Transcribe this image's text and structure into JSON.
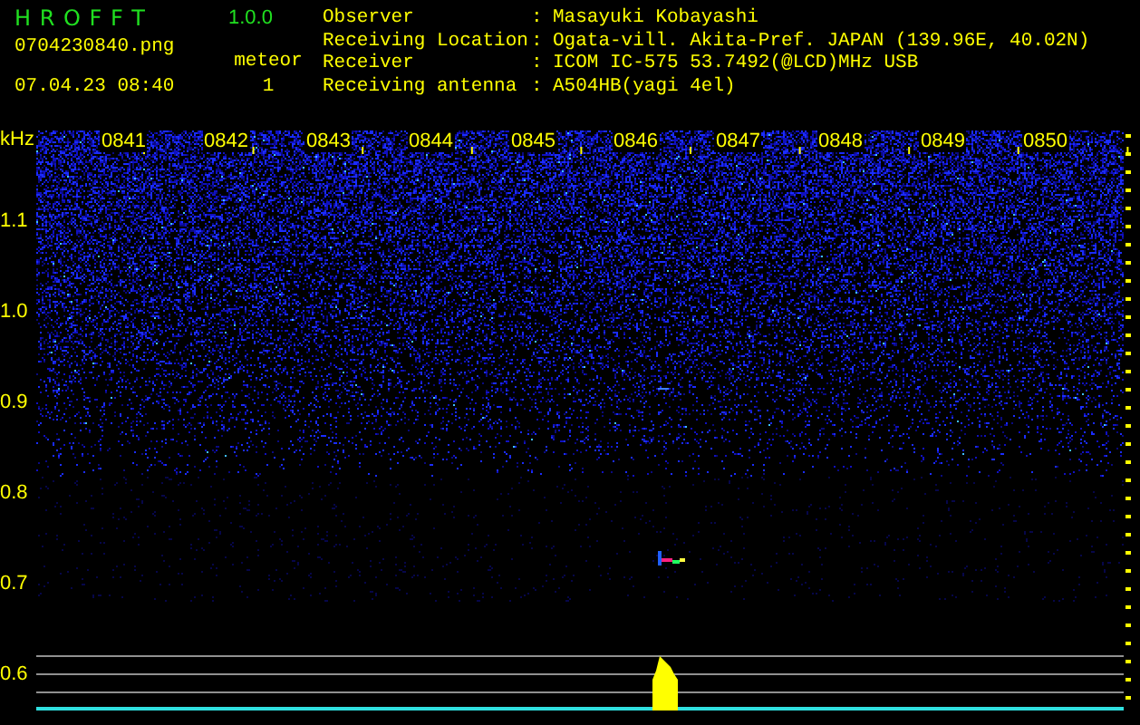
{
  "app": {
    "title": "H R O F F T",
    "version": "1.0.0",
    "file": "0704230840.png",
    "datetime": "07.04.23 08:40",
    "count_label": "meteor",
    "count": "1"
  },
  "station": [
    {
      "label": "Observer",
      "separator": ":",
      "value": "Masayuki Kobayashi"
    },
    {
      "label": "Receiving Location",
      "separator": ":",
      "value": "Ogata-vill. Akita-Pref. JAPAN (139.96E, 40.02N)"
    },
    {
      "label": "Receiver",
      "separator": ":",
      "value": "ICOM IC-575 53.7492(@LCD)MHz USB"
    },
    {
      "label": "Receiving antenna",
      "separator": ":",
      "value": "A504HB(yagi 4el)"
    }
  ],
  "spectrogram": {
    "unit": "kHz",
    "freq_labels": [
      "1.1",
      "1.0",
      "0.9",
      "0.8",
      "0.7",
      "0.6"
    ],
    "time_labels": [
      "0841",
      "0842",
      "0843",
      "0844",
      "0845",
      "0846",
      "0847",
      "0848",
      "0849",
      "0850"
    ]
  }
}
